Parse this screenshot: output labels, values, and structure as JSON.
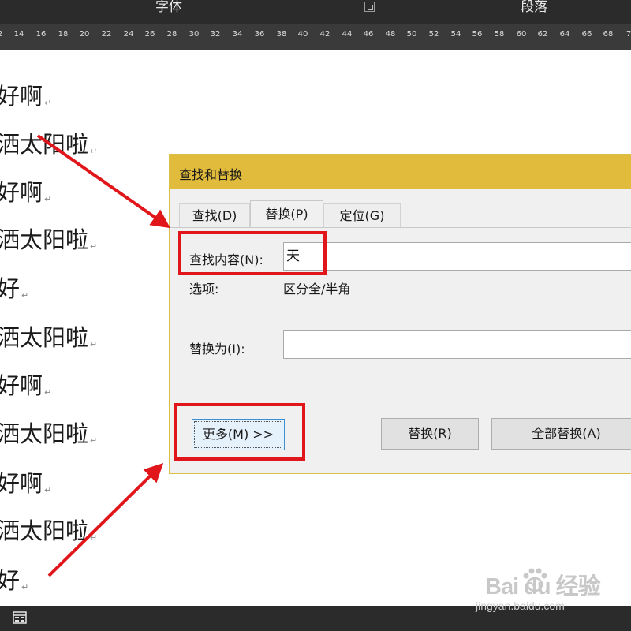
{
  "ribbon": {
    "font_group": "字体",
    "paragraph_group": "段落"
  },
  "ruler": {
    "ticks": [
      "2",
      "14",
      "16",
      "18",
      "20",
      "22",
      "24",
      "26",
      "28",
      "30",
      "32",
      "34",
      "36",
      "38",
      "40",
      "42",
      "44",
      "46",
      "48",
      "50",
      "52",
      "54",
      "56",
      "58",
      "60",
      "62",
      "64",
      "66",
      "68",
      "7"
    ]
  },
  "document": {
    "lines": [
      "好啊",
      "洒太阳啦",
      "好啊",
      "洒太阳啦",
      "好",
      "洒太阳啦",
      "好啊",
      "洒太阳啦",
      "好啊",
      "洒太阳啦",
      "好"
    ],
    "paragraph_mark": "↵"
  },
  "dialog": {
    "title": "查找和替换",
    "tabs": {
      "find": "查找(D)",
      "replace": "替换(P)",
      "goto": "定位(G)"
    },
    "find_label": "查找内容(N):",
    "find_value": "天",
    "options_label": "选项:",
    "options_value": "区分全/半角",
    "replace_label": "替换为(I):",
    "replace_value": "",
    "buttons": {
      "more": "更多(M) >>",
      "replace": "替换(R)",
      "replace_all": "全部替换(A)"
    }
  },
  "watermark": {
    "brand": "Bai du 经验",
    "url": "jingyan.baidu.com"
  },
  "colors": {
    "highlight": "#e0161b",
    "titlebar": "#e1bb3b",
    "dark_chrome": "#2b2b2b"
  }
}
